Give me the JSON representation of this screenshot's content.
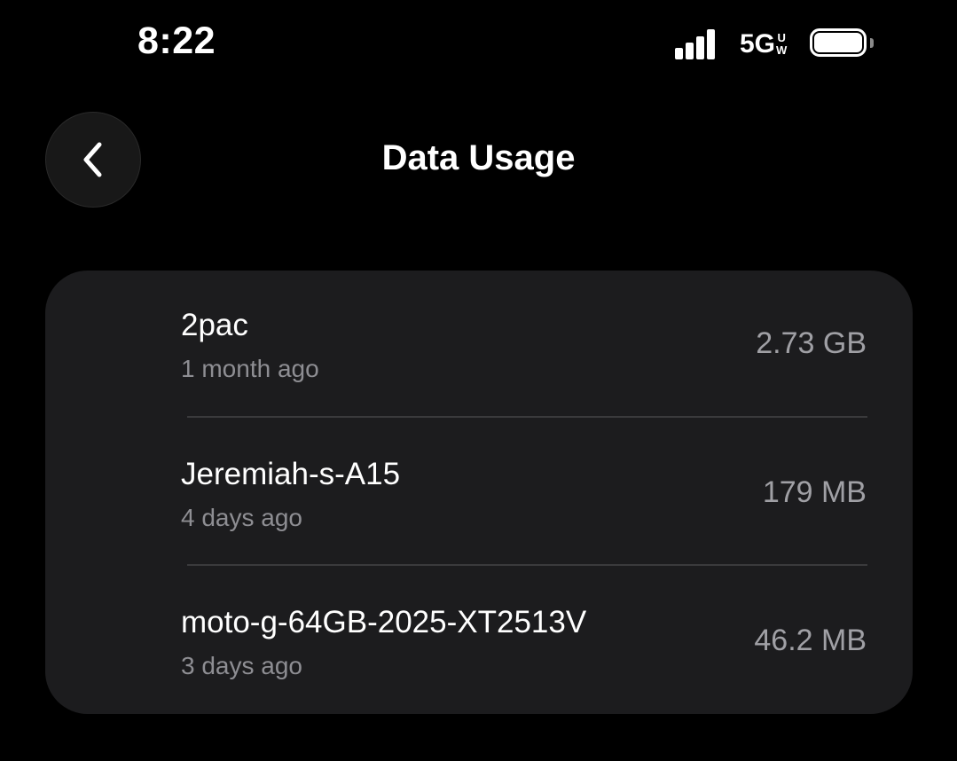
{
  "status_bar": {
    "time": "8:22",
    "network_main": "5G",
    "network_sup_top": "U",
    "network_sup_bottom": "W",
    "signal_icon": "cellular-signal-icon",
    "battery_icon": "battery-icon"
  },
  "header": {
    "back_icon": "chevron-left-icon",
    "title": "Data Usage"
  },
  "devices": [
    {
      "name": "2pac",
      "last_seen": "1 month ago",
      "usage": "2.73 GB"
    },
    {
      "name": "Jeremiah-s-A15",
      "last_seen": "4 days ago",
      "usage": "179 MB"
    },
    {
      "name": "moto-g-64GB-2025-XT2513V",
      "last_seen": "3 days ago",
      "usage": "46.2 MB"
    }
  ],
  "colors": {
    "background": "#000000",
    "card": "#1c1c1e",
    "secondary_text": "#8e8e93",
    "divider": "#3a3a3c"
  }
}
